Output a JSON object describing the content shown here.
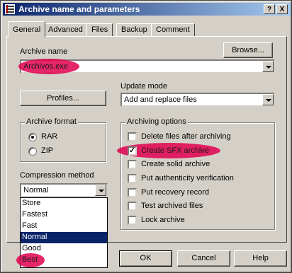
{
  "window": {
    "title": "Archive name and parameters",
    "help_button": "?",
    "close_button": "X"
  },
  "tabs": [
    {
      "label": "General",
      "active": true
    },
    {
      "label": "Advanced",
      "active": false
    },
    {
      "label": "Files",
      "active": false
    },
    {
      "label": "Backup",
      "active": false
    },
    {
      "label": "Comment",
      "active": false
    }
  ],
  "archive_name": {
    "label": "Archive name",
    "value": "Archivos.exe",
    "browse_label": "Browse..."
  },
  "update_mode": {
    "label": "Update mode",
    "value": "Add and replace files"
  },
  "profiles_label": "Profiles...",
  "archive_format": {
    "title": "Archive format",
    "options": [
      {
        "label": "RAR",
        "checked": true
      },
      {
        "label": "ZIP",
        "checked": false
      }
    ]
  },
  "compression": {
    "label": "Compression method",
    "value": "Normal",
    "options": [
      "Store",
      "Fastest",
      "Fast",
      "Normal",
      "Good",
      "Best"
    ],
    "selected": "Normal"
  },
  "archiving_options": {
    "title": "Archiving options",
    "items": [
      {
        "label": "Delete files after archiving",
        "checked": false
      },
      {
        "label": "Create SFX archive",
        "checked": true
      },
      {
        "label": "Create solid archive",
        "checked": false
      },
      {
        "label": "Put authenticity verification",
        "checked": false
      },
      {
        "label": "Put recovery record",
        "checked": false
      },
      {
        "label": "Test archived files",
        "checked": false
      },
      {
        "label": "Lock archive",
        "checked": false
      }
    ]
  },
  "footer": {
    "ok_label": "OK",
    "cancel_label": "Cancel",
    "help_label": "Help"
  },
  "colors": {
    "titlebar": "#0a246a",
    "annotation": "#e0004f",
    "selection": "#0a246a"
  }
}
